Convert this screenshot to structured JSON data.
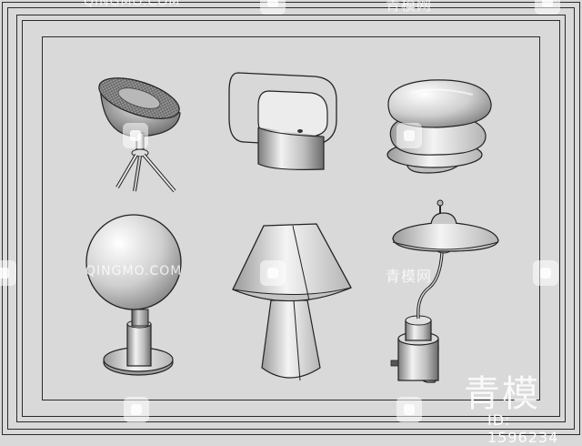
{
  "watermark": {
    "latin": "QINGMO.COM",
    "cjk": "青模网",
    "big": "青模",
    "id": "ID: 1596234"
  },
  "lamps": [
    {
      "name": "spotlight-tripod-lamp"
    },
    {
      "name": "rounded-panel-lamp"
    },
    {
      "name": "ribbed-dome-lamp"
    },
    {
      "name": "globe-table-lamp"
    },
    {
      "name": "cone-shade-table-lamp"
    },
    {
      "name": "saucer-arm-lamp"
    }
  ]
}
